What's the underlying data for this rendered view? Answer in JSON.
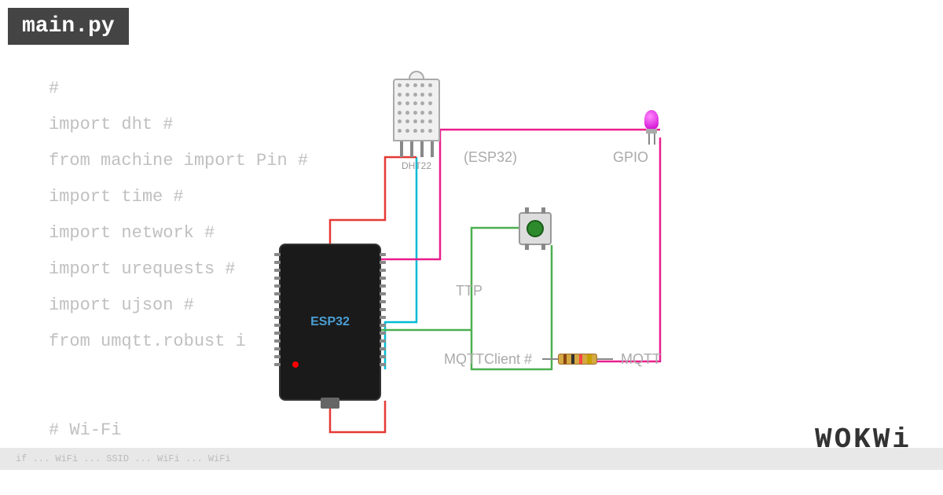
{
  "title_bar": {
    "label": "main.py"
  },
  "code": {
    "lines": [
      "#",
      "import dht #",
      "from machine import Pin #",
      "import time #",
      "import network #",
      "import urequests #",
      "import ujson      #",
      "from umqtt.robust i"
    ]
  },
  "circuit_labels": {
    "dht22": "DHT22",
    "esp32": "(ESP32)",
    "gpio": "GPIO",
    "http": "TTP",
    "mqtt_client": "MQTTClient #",
    "mqtt": "MQTT"
  },
  "bottom_label": "# Wi-Fi",
  "bottom_scroll": "if      ...  WiFi  ...  SSID  ...  WiFi  ...  WiFi",
  "wokwi_logo": "WOKWi",
  "colors": {
    "background": "#ffffff",
    "titlebar_bg": "#444444",
    "code_text": "#c0c0c0",
    "wire_red": "#e53935",
    "wire_cyan": "#00bcd4",
    "wire_green": "#4caf50",
    "wire_magenta": "#e91e8c",
    "esp32_bg": "#1a1a1a",
    "esp32_label": "#4a9fd4"
  }
}
